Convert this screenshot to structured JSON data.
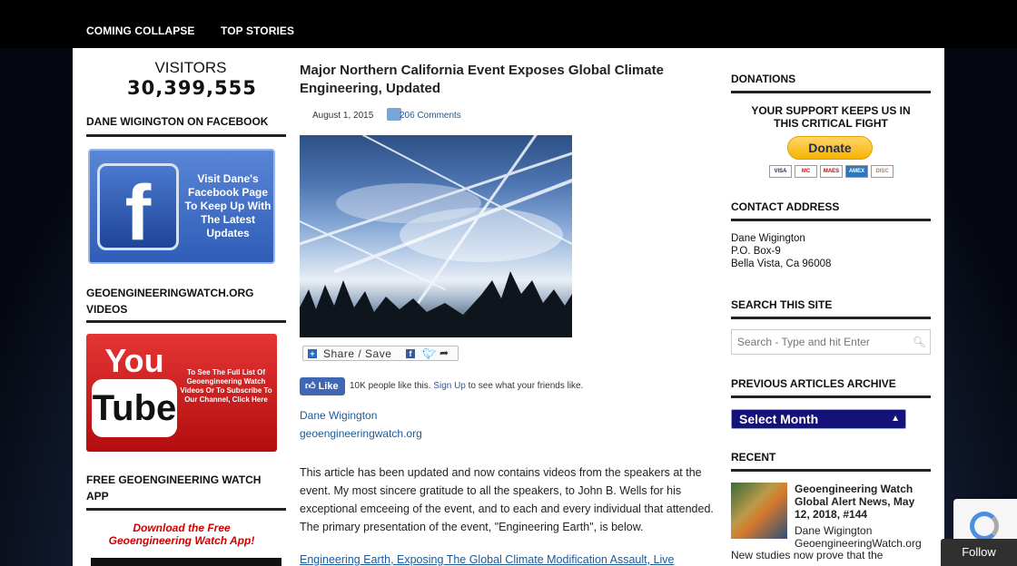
{
  "topnav": {
    "items": [
      {
        "label": "COMING COLLAPSE"
      },
      {
        "label": "TOP STORIES"
      }
    ]
  },
  "left": {
    "visitors_title": "VISITORS",
    "visitors_count": "30,399,555",
    "facebook_heading": "DANE WIGINGTON ON FACEBOOK",
    "facebook_letter": "f",
    "facebook_promo": "Visit Dane's Facebook Page To Keep Up With The Latest Updates",
    "videos_heading": "GEOENGINEERINGWATCH.ORG VIDEOS",
    "youtube_you": "You",
    "youtube_tube": "Tube",
    "youtube_promo": "To See The Full List Of Geoengineering Watch Videos Or To Subscribe To Our Channel, Click Here",
    "app_heading": "FREE GEOENGINEERING WATCH APP",
    "app_promo": "Download the Free Geoengineering Watch App!"
  },
  "post": {
    "title": "Major Northern California Event Exposes Global Climate Engineering, Updated",
    "date": "August 1, 2015",
    "comments": "206 Comments",
    "share_label": "Share / Save",
    "like_label": "Like",
    "like_count_text": "10K people like this.",
    "like_signup": "Sign Up",
    "like_suffix": "to see what your friends like.",
    "author_name": "Dane Wigington",
    "author_site": "geoengineeringwatch.org",
    "body": "This article has been updated and now contains videos from the speakers at the event. My most sincere gratitude to all the speakers, to John B. Wells for his exceptional emceeing of the event, and to each and every individual that attended. The primary presentation of the event, \"Engineering Earth\", is below.",
    "video_link": "Engineering Earth, Exposing The Global Climate Modification Assault, Live"
  },
  "right": {
    "donations_heading": "DONATIONS",
    "support_text": "YOUR SUPPORT KEEPS US IN THIS CRITICAL FIGHT",
    "donate_label": "Donate",
    "cards": [
      "VISA",
      "MC",
      "MAES",
      "AMEX",
      "DISC"
    ],
    "contact_heading": "CONTACT ADDRESS",
    "contact_lines": [
      "Dane Wigington",
      "P.O. Box-9",
      "Bella Vista, Ca 96008"
    ],
    "search_heading": "SEARCH THIS SITE",
    "search_placeholder": "Search - Type and hit Enter",
    "archive_heading": "PREVIOUS ARTICLES ARCHIVE",
    "archive_select": "Select Month",
    "recent_heading": "RECENT",
    "recent_title": "Geoengineering Watch Global Alert News, May 12, 2018, #144",
    "recent_author": "Dane Wigington GeoengineeringWatch.org",
    "recent_snippet": "New studies now prove that the"
  },
  "overlay": {
    "follow_label": "Follow"
  }
}
